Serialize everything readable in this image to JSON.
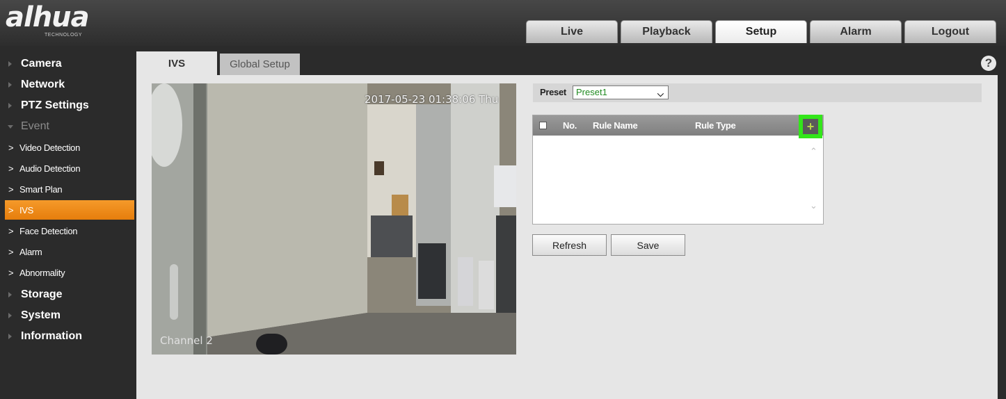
{
  "brand": {
    "logo_text": "alhua",
    "logo_sub": "TECHNOLOGY"
  },
  "nav": {
    "tabs": [
      {
        "label": "Live"
      },
      {
        "label": "Playback"
      },
      {
        "label": "Setup",
        "active": true
      },
      {
        "label": "Alarm"
      },
      {
        "label": "Logout"
      }
    ]
  },
  "sidebar": {
    "items": [
      {
        "label": "Camera"
      },
      {
        "label": "Network"
      },
      {
        "label": "PTZ Settings"
      },
      {
        "label": "Event",
        "expanded": true
      },
      {
        "label": "Video Detection"
      },
      {
        "label": "Audio Detection"
      },
      {
        "label": "Smart Plan"
      },
      {
        "label": "IVS",
        "active": true
      },
      {
        "label": "Face Detection"
      },
      {
        "label": "Alarm"
      },
      {
        "label": "Abnormality"
      },
      {
        "label": "Storage"
      },
      {
        "label": "System"
      },
      {
        "label": "Information"
      }
    ]
  },
  "content_tabs": [
    {
      "label": "IVS",
      "active": true
    },
    {
      "label": "Global Setup"
    }
  ],
  "help_icon": "help-icon",
  "video": {
    "timestamp": "2017-05-23 01:38:06 Thu",
    "channel": "Channel 2"
  },
  "preset": {
    "label": "Preset",
    "value": "Preset1"
  },
  "rule_table": {
    "columns": {
      "no": "No.",
      "rule_name": "Rule Name",
      "rule_type": "Rule Type"
    },
    "rows": [],
    "add_icon": "plus-icon",
    "highlight_color": "#33e61a"
  },
  "buttons": {
    "refresh": "Refresh",
    "save": "Save"
  },
  "colors": {
    "active_sidebar": "#f08a1c",
    "header": "#3a3a3a",
    "panel": "#e6e6e6"
  }
}
